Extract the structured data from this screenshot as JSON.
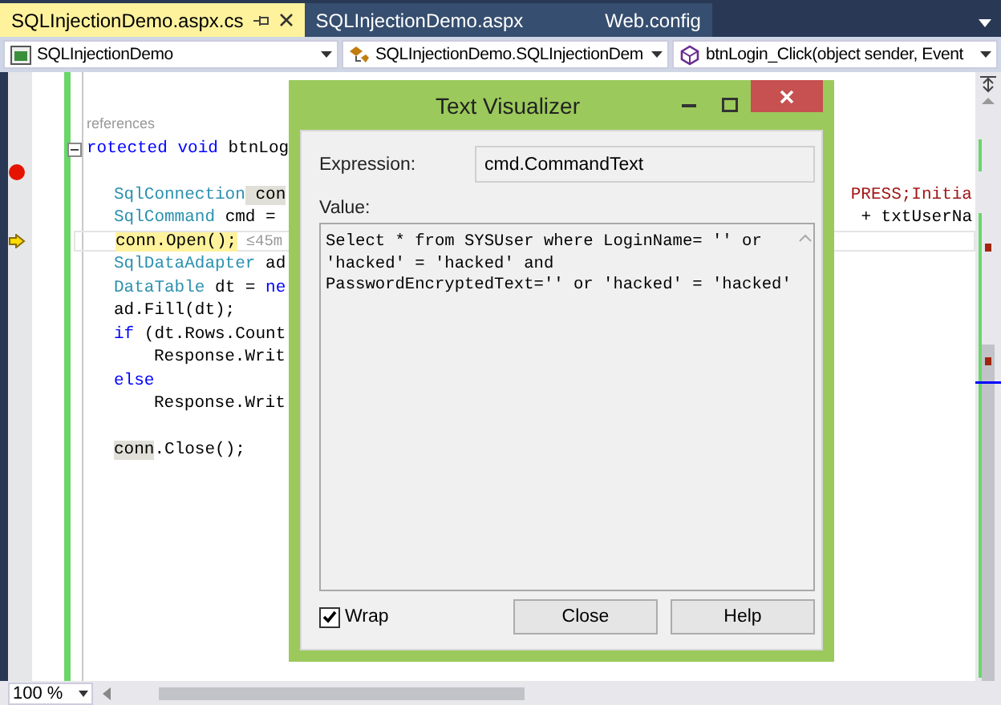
{
  "tabs": [
    {
      "label": "SQLInjectionDemo.aspx.cs",
      "selected": true
    },
    {
      "label": "SQLInjectionDemo.aspx",
      "selected": false
    },
    {
      "label": "Web.config",
      "selected": false
    }
  ],
  "navigation": [
    {
      "kind": "project",
      "label": "SQLInjectionDemo"
    },
    {
      "kind": "class",
      "label": "SQLInjectionDemo.SQLInjectionDem"
    },
    {
      "kind": "method",
      "label": "btnLogin_Click(object sender, Event"
    }
  ],
  "editor": {
    "lines": [
      {
        "kind": "lens",
        "tokens": [
          {
            "kind": "lens",
            "text": "references"
          }
        ]
      },
      {
        "kind": "signature",
        "fold": true,
        "tokens": [
          {
            "kind": "keyword",
            "text": "rotected"
          },
          {
            "kind": "keyword",
            "text": " void"
          },
          {
            "kind": "plain",
            "text": " btnLog"
          }
        ]
      },
      {
        "kind": "blank",
        "breakpoint": true
      },
      {
        "kind": "statement",
        "tokens": [
          {
            "kind": "type",
            "text": "SqlConnection"
          },
          {
            "kind": "reference",
            "text": " con"
          }
        ],
        "tail": {
          "kind": "string",
          "text": "PRESS;Initia"
        }
      },
      {
        "kind": "statement",
        "tokens": [
          {
            "kind": "type",
            "text": "SqlCommand"
          },
          {
            "kind": "plain",
            "text": " cmd ="
          }
        ],
        "tail": {
          "kind": "plain",
          "text": "+ txtUserNa"
        }
      },
      {
        "kind": "statement",
        "next_statement": true,
        "tokens": [
          {
            "kind": "executing",
            "text": "conn.Open();"
          },
          {
            "kind": "hint",
            "text": " ≤45m"
          }
        ]
      },
      {
        "kind": "statement",
        "tokens": [
          {
            "kind": "type",
            "text": "SqlDataAdapter"
          },
          {
            "kind": "plain",
            "text": " ad"
          }
        ]
      },
      {
        "kind": "statement",
        "tokens": [
          {
            "kind": "type",
            "text": "DataTable"
          },
          {
            "kind": "plain",
            "text": " dt = "
          },
          {
            "kind": "keyword",
            "text": "ne"
          }
        ]
      },
      {
        "kind": "statement",
        "tokens": [
          {
            "kind": "plain",
            "text": "ad.Fill(dt);"
          }
        ]
      },
      {
        "kind": "statement",
        "tokens": [
          {
            "kind": "keyword",
            "text": "if"
          },
          {
            "kind": "plain",
            "text": " (dt.Rows.Count"
          }
        ]
      },
      {
        "kind": "nested",
        "tokens": [
          {
            "kind": "plain",
            "text": "Response.Writ"
          }
        ]
      },
      {
        "kind": "statement",
        "tokens": [
          {
            "kind": "keyword",
            "text": "else"
          }
        ]
      },
      {
        "kind": "nested",
        "tokens": [
          {
            "kind": "plain",
            "text": "Response.Writ"
          }
        ]
      },
      {
        "kind": "blank"
      },
      {
        "kind": "statement",
        "tokens": [
          {
            "kind": "reference",
            "text": "conn"
          },
          {
            "kind": "plain",
            "text": ".Close();"
          }
        ]
      }
    ]
  },
  "dialog": {
    "title": "Text Visualizer",
    "expression_label": "Expression:",
    "expression": "cmd.CommandText",
    "value_label": "Value:",
    "value": "Select * from SYSUser where LoginName= '' or\n'hacked' = 'hacked' and\nPasswordEncryptedText='' or 'hacked' = 'hacked'",
    "wrap": {
      "label": "Wrap",
      "checked": true
    },
    "buttons": [
      "Close",
      "Help"
    ]
  },
  "status": {
    "zoom": "100 %"
  }
}
